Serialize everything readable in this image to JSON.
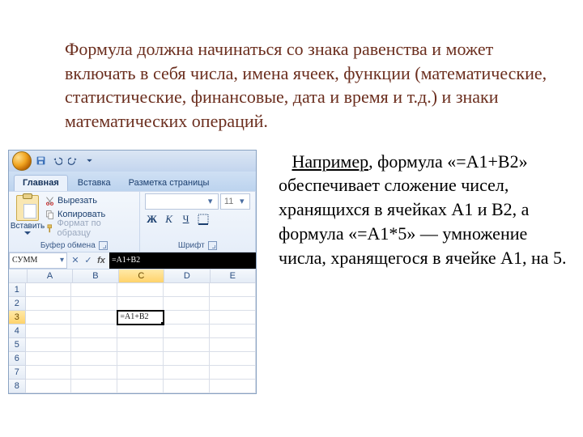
{
  "heading": "Формула должна начинаться со знака равенства и может включать в себя числа, имена ячеек, функции (математические, статистические, финансовые, дата и время и т.д.) и знаки математических операций.",
  "paragraph": {
    "lead": "Например",
    "rest": ", формула «=А1+В2» обеспечивает сложение чисел, хранящихся в ячейках А1 и В2, а формула «=А1*5» — умножение числа, хранящегося в ячейке А1, на 5."
  },
  "excel": {
    "tabs": {
      "home": "Главная",
      "insert": "Вставка",
      "layout": "Разметка страницы"
    },
    "clipboard": {
      "paste": "Вставить",
      "cut": "Вырезать",
      "copy": "Копировать",
      "format_painter": "Формат по образцу",
      "group": "Буфер обмена"
    },
    "font": {
      "size": "11",
      "bold": "Ж",
      "italic": "К",
      "underline": "Ч",
      "group": "Шрифт"
    },
    "namebox": "СУММ",
    "formula": "=A1+B2",
    "columns": [
      "A",
      "B",
      "C",
      "D",
      "E"
    ],
    "rows": [
      "1",
      "2",
      "3",
      "4",
      "5",
      "6",
      "7",
      "8"
    ],
    "active_cell_text": "=A1+B2"
  }
}
